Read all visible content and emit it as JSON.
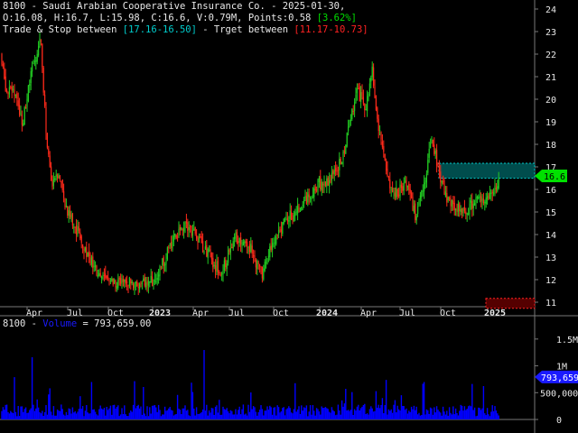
{
  "header": {
    "line1": "8100 - Saudi Arabian Cooperative Insurance Co. - 2025-01-30,",
    "line2_prefix": "O:16.08, H:16.7, L:15.98, C:16.6, V:0.79M, Points:0.58 ",
    "line2_change": "[3.62%]",
    "line3_a": "Trade & Stop between ",
    "line3_b": "[17.16-16.50]",
    "line3_c": " - Trget between ",
    "line3_d": "[11.17-10.73]"
  },
  "volume_header": {
    "prefix": "8100 - ",
    "series": "Volume",
    "value": " = 793,659.00"
  },
  "colors": {
    "up": "#22cc22",
    "down": "#ff2a1a",
    "cyan": "#00cccc",
    "red_label": "#ff2222",
    "volume": "#0000ff",
    "price_badge": "#00e000",
    "vol_badge": "#1a1aff"
  },
  "chart_data": [
    {
      "type": "candlestick",
      "x_tick_labels": [
        "Apr",
        "Jul",
        "Oct",
        "2023",
        "Apr",
        "Jul",
        "Oct",
        "2024",
        "Apr",
        "Jul",
        "Oct",
        "2025"
      ],
      "y_tick_labels": [
        "11",
        "12",
        "13",
        "14",
        "15",
        "16",
        "17",
        "18",
        "19",
        "20",
        "21",
        "22",
        "23",
        "24"
      ],
      "ylim": [
        10.8,
        24.4
      ],
      "last_price_label": "16.6",
      "last_close": 16.6,
      "trade_stop_zone": [
        16.5,
        17.16
      ],
      "target_zone": [
        10.73,
        11.17
      ],
      "anchors": [
        [
          0,
          22.0
        ],
        [
          8,
          20.2
        ],
        [
          15,
          20.5
        ],
        [
          25,
          19.0
        ],
        [
          35,
          21.2
        ],
        [
          45,
          22.8
        ],
        [
          52,
          17.8
        ],
        [
          58,
          16.1
        ],
        [
          65,
          16.6
        ],
        [
          75,
          15.0
        ],
        [
          90,
          13.8
        ],
        [
          105,
          12.4
        ],
        [
          120,
          11.9
        ],
        [
          135,
          11.9
        ],
        [
          150,
          11.8
        ],
        [
          165,
          11.8
        ],
        [
          175,
          12.3
        ],
        [
          190,
          13.6
        ],
        [
          205,
          14.6
        ],
        [
          215,
          14.0
        ],
        [
          230,
          13.2
        ],
        [
          245,
          12.2
        ],
        [
          260,
          13.9
        ],
        [
          275,
          13.6
        ],
        [
          290,
          12.2
        ],
        [
          305,
          13.9
        ],
        [
          320,
          14.8
        ],
        [
          335,
          15.4
        ],
        [
          350,
          16.2
        ],
        [
          365,
          16.4
        ],
        [
          380,
          17.5
        ],
        [
          395,
          20.5
        ],
        [
          405,
          19.5
        ],
        [
          412,
          21.5
        ],
        [
          418,
          19.0
        ],
        [
          425,
          17.5
        ],
        [
          432,
          16.0
        ],
        [
          440,
          15.8
        ],
        [
          450,
          16.4
        ],
        [
          460,
          14.8
        ],
        [
          470,
          16.2
        ],
        [
          478,
          18.5
        ],
        [
          486,
          16.6
        ],
        [
          495,
          15.6
        ],
        [
          505,
          15.2
        ],
        [
          515,
          15.0
        ],
        [
          525,
          15.4
        ],
        [
          535,
          15.6
        ],
        [
          545,
          15.8
        ],
        [
          553,
          16.6
        ]
      ]
    },
    {
      "type": "bar",
      "series": [
        {
          "name": "Volume"
        }
      ],
      "y_tick_labels": [
        "0",
        "500,000",
        "1M",
        "1.5M"
      ],
      "ylim": [
        0,
        1800000
      ],
      "last_value": 793659,
      "last_value_label": "793,659"
    }
  ]
}
